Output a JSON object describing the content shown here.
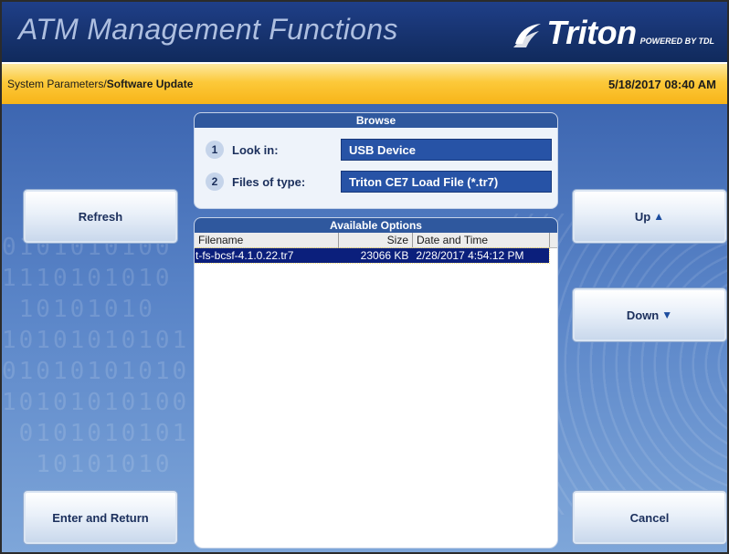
{
  "header": {
    "title": "ATM Management Functions",
    "logo_text": "Triton",
    "logo_sub": "POWERED BY TDL"
  },
  "breadcrumb": {
    "parent": "System Parameters/",
    "current": "Software Update"
  },
  "datetime": "5/18/2017  08:40 AM",
  "buttons": {
    "refresh": "Refresh",
    "enter_return": "Enter and Return",
    "up": "Up",
    "up_arrow": "▲",
    "down": "Down",
    "down_arrow": "▼",
    "cancel": "Cancel"
  },
  "browse": {
    "title": "Browse",
    "look_in": {
      "number": "1",
      "label": "Look in:",
      "value": "USB Device"
    },
    "files_of_type": {
      "number": "2",
      "label": "Files of type:",
      "value": "Triton CE7 Load File (*.tr7)"
    }
  },
  "options": {
    "title": "Available Options",
    "columns": {
      "filename": "Filename",
      "size": "Size",
      "date": "Date and Time"
    },
    "rows": [
      {
        "filename": "t-fs-bcsf-4.1.0.22.tr7",
        "size": "23066 KB",
        "date": "2/28/2017 4:54:12 PM",
        "selected": true
      }
    ]
  },
  "colors": {
    "header_blue": "#17336f",
    "bar_yellow": "#fcc93a",
    "panel_blue": "#2f589e",
    "selection": "#0b1f7c"
  },
  "icons": {
    "logo_mark": "triton-swoosh-icon"
  }
}
